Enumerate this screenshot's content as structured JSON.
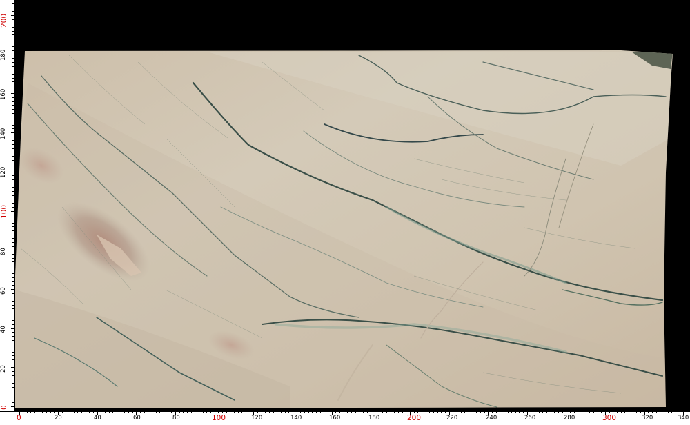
{
  "image": {
    "subject": "marble-slab-photo",
    "colors": {
      "background": "#000000",
      "stone_base": "#d2c7b4",
      "stone_warm": "#c9b49c",
      "vein_green": "#4f6a5e",
      "vein_dark": "#2d3e3a",
      "rust_patch": "#a9867a",
      "ruler_bg": "#ffffff",
      "tick_major_label": "#d00000"
    }
  },
  "rulers": {
    "left": {
      "labels": [
        "0",
        "20",
        "40",
        "60",
        "80",
        "100",
        "120",
        "140",
        "160",
        "180",
        "200"
      ],
      "emphasized": [
        "0",
        "100",
        "200"
      ]
    },
    "bottom": {
      "labels": [
        "0",
        "20",
        "40",
        "60",
        "80",
        "100",
        "120",
        "140",
        "160",
        "180",
        "200",
        "220",
        "240",
        "260",
        "280",
        "300",
        "320",
        "340"
      ],
      "emphasized": [
        "0",
        "100",
        "200",
        "300"
      ]
    }
  }
}
